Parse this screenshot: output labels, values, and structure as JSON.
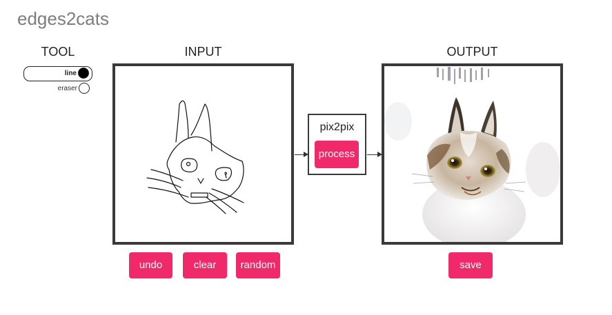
{
  "app": {
    "title": "edges2cats"
  },
  "sections": {
    "tool": "TOOL",
    "input": "INPUT",
    "output": "OUTPUT"
  },
  "tools": {
    "line": "line",
    "eraser": "eraser",
    "selected": "line"
  },
  "model": {
    "name": "pix2pix",
    "process_label": "process"
  },
  "buttons": {
    "undo": "undo",
    "clear": "clear",
    "random": "random",
    "save": "save"
  },
  "colors": {
    "accent": "#f0296a",
    "border": "#3a3a3a",
    "title": "#7d7d7d"
  }
}
